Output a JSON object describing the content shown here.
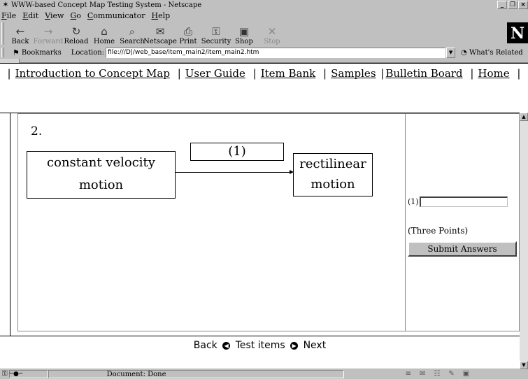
{
  "window": {
    "title": "WWW-based Concept Map Testing System - Netscape",
    "app_icon": "netscape-icon",
    "controls": [
      "_",
      "×"
    ]
  },
  "menu": [
    {
      "ul": "F",
      "rest": "ile"
    },
    {
      "ul": "E",
      "rest": "dit"
    },
    {
      "ul": "V",
      "rest": "iew"
    },
    {
      "ul": "G",
      "rest": "o"
    },
    {
      "ul": "C",
      "rest": "ommunicator"
    },
    {
      "ul": "H",
      "rest": "elp"
    }
  ],
  "toolbar": {
    "buttons": [
      {
        "label": "Back",
        "icon": "←",
        "enabled": true
      },
      {
        "label": "Forward",
        "icon": "→",
        "enabled": false
      },
      {
        "label": "Reload",
        "icon": "↻",
        "enabled": true
      },
      {
        "label": "Home",
        "icon": "⌂",
        "enabled": true
      },
      {
        "label": "Search",
        "icon": "⌕",
        "enabled": true
      },
      {
        "label": "Netscape",
        "icon": "✉",
        "enabled": true
      },
      {
        "label": "Print",
        "icon": "⎙",
        "enabled": true
      },
      {
        "label": "Security",
        "icon": "⚿",
        "enabled": true
      },
      {
        "label": "Shop",
        "icon": "▣",
        "enabled": true
      },
      {
        "label": "Stop",
        "icon": "✕",
        "enabled": false
      }
    ],
    "logo": "N"
  },
  "locationbar": {
    "bookmarks_label": "Bookmarks",
    "location_label": "Location:",
    "url": "file:///D|/web_base/item_main2/item_main2.htm",
    "related_label": "What's Related"
  },
  "topnav": {
    "links": [
      "Introduction to Concept Map",
      "User Guide",
      "Item Bank",
      "Samples",
      "Bulletin Board",
      "Home"
    ],
    "separator": "|"
  },
  "question": {
    "number": "2.",
    "left_concept": [
      "constant velocity",
      "motion"
    ],
    "right_concept": [
      "rectilinear",
      "motion"
    ],
    "link_label": "(1)"
  },
  "answer": {
    "field_label": "(1)",
    "value": "",
    "points": "(Three Points)",
    "submit_label": "Submit Answers"
  },
  "bottomnav": {
    "back": "Back",
    "middle": "Test items",
    "next": "Next"
  },
  "status": {
    "message": "Document: Done"
  }
}
